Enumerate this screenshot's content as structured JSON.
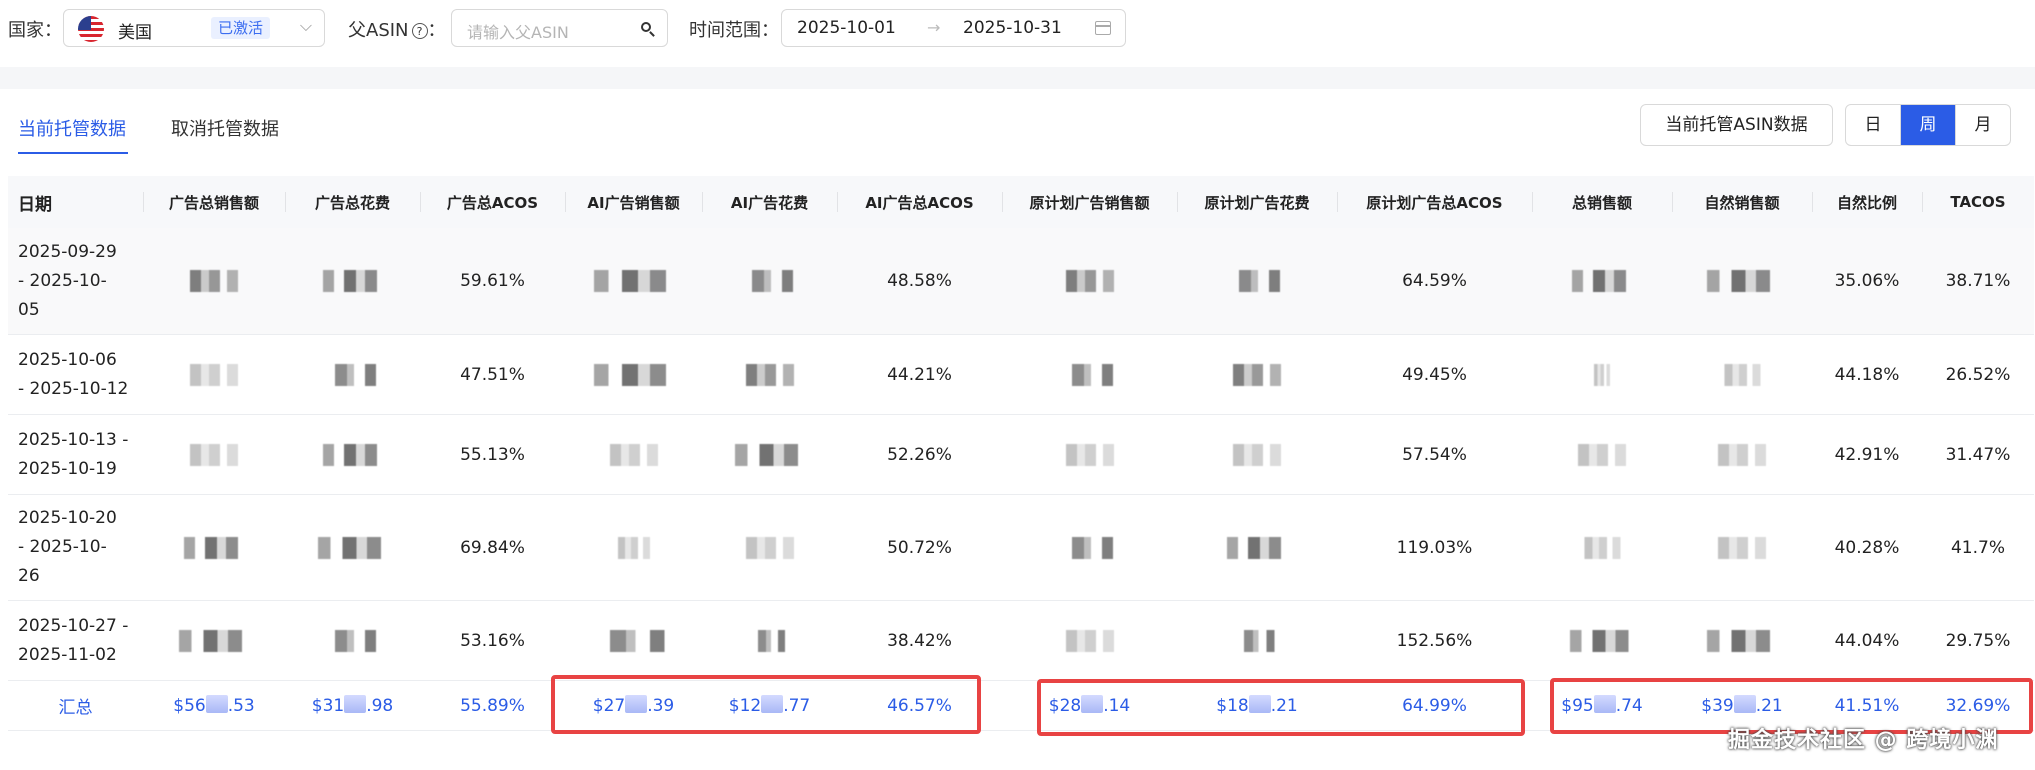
{
  "filters": {
    "country_label": "国家：",
    "country_value": "美国",
    "country_badge": "已激活",
    "parent_asin_label": "父ASIN",
    "help_mark": "?",
    "parent_asin_colon": "：",
    "parent_asin_placeholder": "请输入父ASIN",
    "time_label": "时间范围：",
    "date_start": "2025-10-01",
    "date_arrow": "→",
    "date_end": "2025-10-31"
  },
  "tabs": [
    "当前托管数据",
    "取消托管数据"
  ],
  "toolbar": {
    "asin_button": "当前托管ASIN数据",
    "granularity": [
      "日",
      "周",
      "月"
    ],
    "granularity_active": "周"
  },
  "table": {
    "headers": [
      "日期",
      "广告总销售额",
      "广告总花费",
      "广告总ACOS",
      "AI广告销售额",
      "AI广告花费",
      "AI广告总ACOS",
      "原计划广告销售额",
      "原计划广告花费",
      "原计划广告总ACOS",
      "总销售额",
      "自然销售额",
      "自然比例",
      "TACOS"
    ],
    "rows": [
      {
        "date_lines": [
          "2025-09-29",
          "- 2025-10-",
          "05"
        ],
        "ad_acos": "59.61%",
        "ai_acos": "48.58%",
        "orig_acos": "64.59%",
        "organic_ratio": "35.06%",
        "tacos": "38.71%"
      },
      {
        "date_lines": [
          "2025-10-06",
          "- 2025-10-12"
        ],
        "ad_acos": "47.51%",
        "ai_acos": "44.21%",
        "orig_acos": "49.45%",
        "organic_ratio": "44.18%",
        "tacos": "26.52%"
      },
      {
        "date_lines": [
          "2025-10-13 -",
          "2025-10-19"
        ],
        "ad_acos": "55.13%",
        "ai_acos": "52.26%",
        "orig_acos": "57.54%",
        "organic_ratio": "42.91%",
        "tacos": "31.47%"
      },
      {
        "date_lines": [
          "2025-10-20",
          "- 2025-10-",
          "26"
        ],
        "ad_acos": "69.84%",
        "ai_acos": "50.72%",
        "orig_acos": "119.03%",
        "organic_ratio": "40.28%",
        "tacos": "41.7%"
      },
      {
        "date_lines": [
          "2025-10-27 -",
          "2025-11-02"
        ],
        "ad_acos": "53.16%",
        "ai_acos": "38.42%",
        "orig_acos": "152.56%",
        "organic_ratio": "44.04%",
        "tacos": "29.75%"
      }
    ],
    "total": {
      "label": "汇总",
      "ad_sales": [
        "$56",
        ".53"
      ],
      "ad_spend": [
        "$31",
        ".98"
      ],
      "ad_acos": "55.89%",
      "ai_sales": [
        "$27",
        ".39"
      ],
      "ai_spend": [
        "$12",
        ".77"
      ],
      "ai_acos": "46.57%",
      "orig_sales": [
        "$28",
        ".14"
      ],
      "orig_spend": [
        "$18",
        ".21"
      ],
      "orig_acos": "64.99%",
      "total_sales": [
        "$95",
        ".74"
      ],
      "organic_sales": [
        "$39",
        ".21"
      ],
      "organic_ratio": "41.51%",
      "tacos": "32.69%"
    }
  },
  "watermark": "掘金技术社区 @ 跨境小渊",
  "colors": {
    "accent": "#2b5ce6",
    "highlight": "#e84343"
  }
}
